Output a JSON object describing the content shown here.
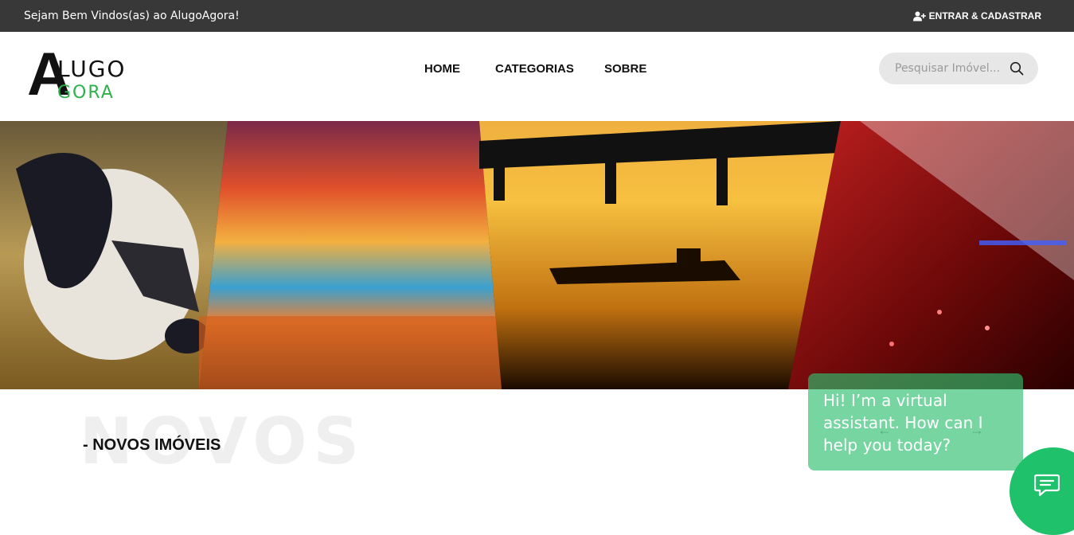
{
  "topbar": {
    "welcome": "Sejam Bem Vindos(as) ao AlugoAgora!",
    "login_label": "ENTRAR & CADASTRAR",
    "login_icon": "user-plus-icon"
  },
  "logo": {
    "letter": "A",
    "line1": "LUGO",
    "line2": "GORA"
  },
  "nav": {
    "items": [
      "HOME",
      "CATEGORIAS",
      "SOBRE"
    ]
  },
  "search": {
    "placeholder": "Pesquisar Imóvel...",
    "icon": "search-icon"
  },
  "section": {
    "background_word": "NOVOS",
    "title": "- NOVOS IMÓVEIS"
  },
  "assistant": {
    "message": "Hi! I’m a virtual assistant. How can I help you today?"
  },
  "colors": {
    "topbar": "#383838",
    "accent_green": "#2db24a",
    "chat_green": "#1fc16b"
  }
}
